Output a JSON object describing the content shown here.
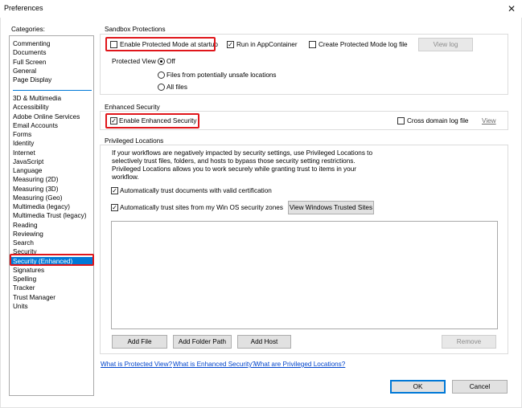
{
  "window": {
    "title": "Preferences",
    "close_glyph": "✕"
  },
  "categories": {
    "label": "Categories:",
    "top_items": [
      "Commenting",
      "Documents",
      "Full Screen",
      "General",
      "Page Display"
    ],
    "items": [
      "3D & Multimedia",
      "Accessibility",
      "Adobe Online Services",
      "Email Accounts",
      "Forms",
      "Identity",
      "Internet",
      "JavaScript",
      "Language",
      "Measuring (2D)",
      "Measuring (3D)",
      "Measuring (Geo)",
      "Multimedia (legacy)",
      "Multimedia Trust (legacy)",
      "Reading",
      "Reviewing",
      "Search",
      "Security",
      "Security (Enhanced)",
      "Signatures",
      "Spelling",
      "Tracker",
      "Trust Manager",
      "Units"
    ],
    "selected": "Security (Enhanced)"
  },
  "sandbox": {
    "title": "Sandbox Protections",
    "protected_mode": {
      "label": "Enable Protected Mode at startup",
      "checked": false
    },
    "appcontainer": {
      "label": "Run in AppContainer",
      "checked": true
    },
    "log_file": {
      "label": "Create Protected Mode log file",
      "checked": false
    },
    "view_log": "View log",
    "protected_view_label": "Protected View",
    "options": [
      {
        "label": "Off",
        "selected": true
      },
      {
        "label": "Files from potentially unsafe locations",
        "selected": false
      },
      {
        "label": "All files",
        "selected": false
      }
    ]
  },
  "enhanced": {
    "title": "Enhanced Security",
    "enable": {
      "label": "Enable Enhanced Security",
      "checked": true
    },
    "cross_domain": {
      "label": "Cross domain log file",
      "checked": false
    },
    "view": "View"
  },
  "privileged": {
    "title": "Privileged Locations",
    "description": [
      "If your workflows are negatively impacted by security settings, use Privileged Locations to",
      "selectively trust files, folders, and hosts to bypass those security setting restrictions.",
      "Privileged Locations allows you to work securely while granting trust to items in your",
      "workflow."
    ],
    "trust_cert": {
      "label": "Automatically trust documents with valid certification",
      "checked": true
    },
    "trust_win": {
      "label": "Automatically trust sites from my Win OS security zones",
      "checked": true
    },
    "view_sites": "View Windows Trusted Sites",
    "add_file": "Add File",
    "add_folder": "Add Folder Path",
    "add_host": "Add Host",
    "remove": "Remove"
  },
  "links": {
    "protected_view": "What is Protected View?",
    "enhanced_security": "What is Enhanced Security?",
    "privileged_locations": "What are Privileged Locations?"
  },
  "footer": {
    "ok": "OK",
    "cancel": "Cancel"
  },
  "check_glyph": "✓",
  "colors": {
    "selection": "#0078d7",
    "highlight": "#e0161b",
    "link": "#0044cc"
  }
}
